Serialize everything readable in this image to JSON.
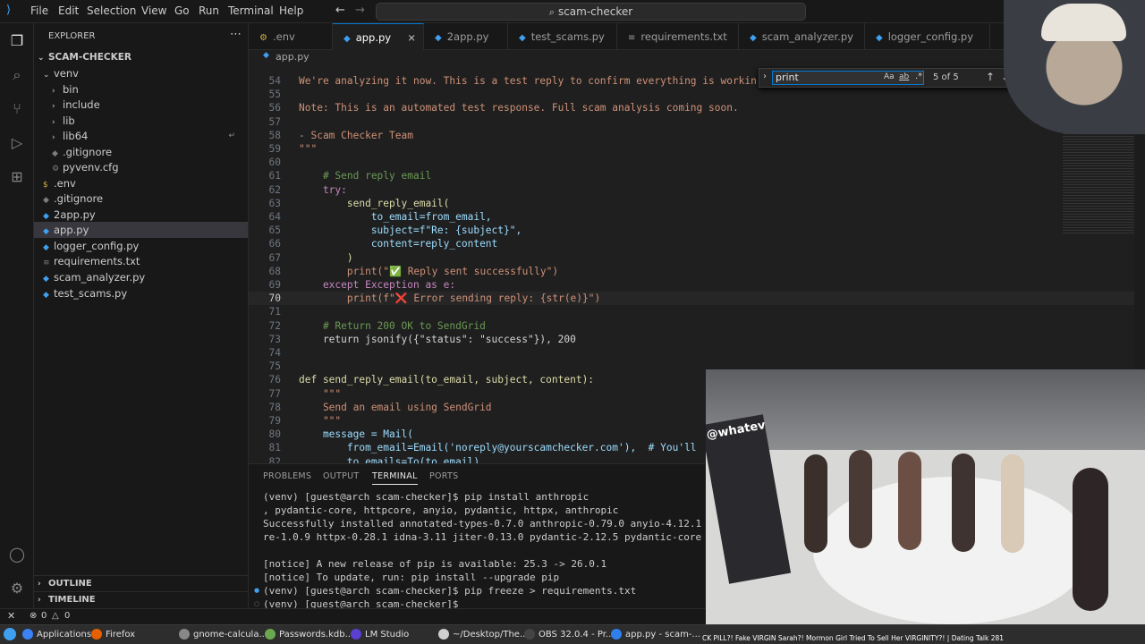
{
  "menu": {
    "items": [
      "File",
      "Edit",
      "Selection",
      "View",
      "Go",
      "Run",
      "Terminal",
      "Help"
    ]
  },
  "command_center": {
    "label": "scam-checker"
  },
  "sidebar": {
    "title": "EXPLORER",
    "root": "SCAM-CHECKER",
    "items": [
      {
        "label": "venv",
        "level": 1,
        "type": "folder-open"
      },
      {
        "label": "bin",
        "level": 2,
        "type": "folder"
      },
      {
        "label": "include",
        "level": 2,
        "type": "folder"
      },
      {
        "label": "lib",
        "level": 2,
        "type": "folder"
      },
      {
        "label": "lib64",
        "level": 2,
        "type": "folder"
      },
      {
        "label": ".gitignore",
        "level": 2,
        "type": "file"
      },
      {
        "label": "pyvenv.cfg",
        "level": 2,
        "type": "file"
      },
      {
        "label": ".env",
        "level": 1,
        "type": "file"
      },
      {
        "label": ".gitignore",
        "level": 1,
        "type": "file"
      },
      {
        "label": "2app.py",
        "level": 1,
        "type": "file"
      },
      {
        "label": "app.py",
        "level": 1,
        "type": "file",
        "selected": true
      },
      {
        "label": "logger_config.py",
        "level": 1,
        "type": "file"
      },
      {
        "label": "requirements.txt",
        "level": 1,
        "type": "file"
      },
      {
        "label": "scam_analyzer.py",
        "level": 1,
        "type": "file"
      },
      {
        "label": "test_scams.py",
        "level": 1,
        "type": "file"
      }
    ],
    "outline": "OUTLINE",
    "timeline": "TIMELINE"
  },
  "tabs": [
    {
      "label": ".env",
      "active": false
    },
    {
      "label": "app.py",
      "active": true
    },
    {
      "label": "2app.py",
      "active": false
    },
    {
      "label": "test_scams.py",
      "active": false
    },
    {
      "label": "requirements.txt",
      "active": false
    },
    {
      "label": "scam_analyzer.py",
      "active": false
    },
    {
      "label": "logger_config.py",
      "active": false
    }
  ],
  "breadcrumb": "app.py",
  "find": {
    "query": "print",
    "count": "5 of 5"
  },
  "editor_lines": [
    {
      "n": "54",
      "t": "We're analyzing it now. This is a test reply to confirm everything is workin"
    },
    {
      "n": "55",
      "t": ""
    },
    {
      "n": "56",
      "t": "Note: This is an automated test response. Full scam analysis coming soon."
    },
    {
      "n": "57",
      "t": ""
    },
    {
      "n": "58",
      "t": "- Scam Checker Team"
    },
    {
      "n": "59",
      "t": "\"\"\""
    },
    {
      "n": "60",
      "t": ""
    },
    {
      "n": "61",
      "t": "    # Send reply email"
    },
    {
      "n": "62",
      "t": "    try:"
    },
    {
      "n": "63",
      "t": "        send_reply_email("
    },
    {
      "n": "64",
      "t": "            to_email=from_email,"
    },
    {
      "n": "65",
      "t": "            subject=f\"Re: {subject}\","
    },
    {
      "n": "66",
      "t": "            content=reply_content"
    },
    {
      "n": "67",
      "t": "        )"
    },
    {
      "n": "68",
      "t": "        print(\"✅ Reply sent successfully\")"
    },
    {
      "n": "69",
      "t": "    except Exception as e:"
    },
    {
      "n": "70",
      "t": "        print(f\"❌ Error sending reply: {str(e)}\")"
    },
    {
      "n": "71",
      "t": ""
    },
    {
      "n": "72",
      "t": "    # Return 200 OK to SendGrid"
    },
    {
      "n": "73",
      "t": "    return jsonify({\"status\": \"success\"}), 200"
    },
    {
      "n": "74",
      "t": ""
    },
    {
      "n": "75",
      "t": ""
    },
    {
      "n": "76",
      "t": "def send_reply_email(to_email, subject, content):"
    },
    {
      "n": "77",
      "t": "    \"\"\""
    },
    {
      "n": "78",
      "t": "    Send an email using SendGrid"
    },
    {
      "n": "79",
      "t": "    \"\"\""
    },
    {
      "n": "80",
      "t": "    message = Mail("
    },
    {
      "n": "81",
      "t": "        from_email=Email('noreply@yourscamchecker.com'),  # You'll"
    },
    {
      "n": "82",
      "t": "        to_emails=To(to_email),"
    }
  ],
  "panel": {
    "tabs": [
      "PROBLEMS",
      "OUTPUT",
      "TERMINAL",
      "PORTS"
    ],
    "active_tab": "TERMINAL",
    "terminal_lines": [
      "(venv) [guest@arch scam-checker]$ pip install anthropic",
      ", pydantic-core, httpcore, anyio, pydantic, httpx, anthropic",
      "Successfully installed annotated-types-0.7.0 anthropic-0.79.0 anyio-4.12.1",
      "re-1.0.9 httpx-0.28.1 idna-3.11 jiter-0.13.0 pydantic-2.12.5 pydantic-core",
      "",
      "[notice] A new release of pip is available: 25.3 -> 26.0.1",
      "[notice] To update, run: pip install --upgrade pip",
      "(venv) [guest@arch scam-checker]$ pip freeze > requirements.txt",
      "(venv) [guest@arch scam-checker]$ "
    ]
  },
  "status": {
    "errors": "0",
    "warnings": "0"
  },
  "taskbar": {
    "items": [
      {
        "label": "Applications",
        "color": "#3b82f6"
      },
      {
        "label": "Firefox",
        "color": "#e66000"
      },
      {
        "label": "gnome-calcula...",
        "color": "#888888"
      },
      {
        "label": "Passwords.kdb...",
        "color": "#6aa84f"
      },
      {
        "label": "LM Studio",
        "color": "#5b3fd1"
      },
      {
        "label": "~/Desktop/The...",
        "color": "#cfcfcf"
      },
      {
        "label": "OBS 32.0.4 - Pr...",
        "color": "#444444"
      },
      {
        "label": "app.py - scam-...",
        "color": "#2f80ed"
      }
    ],
    "stream_title": "CK PILL?! Fake VIRGIN Sarah?! Mormon Girl Tried To Sell Her VIRGINITY?! | Dating Talk 281"
  },
  "stream_overlay": "@whatever"
}
